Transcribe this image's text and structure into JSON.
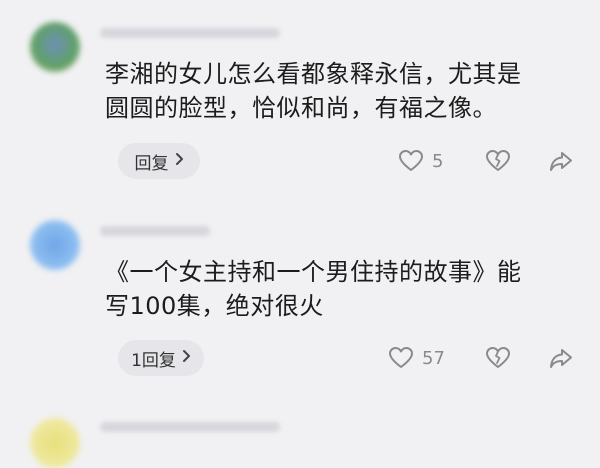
{
  "comments": [
    {
      "text_line1": "李湘的女儿怎么看都象释永信，尤其是",
      "text_line2": "圆圆的脸型，恰似和尚，有福之像。",
      "reply_label": "回复",
      "like_count": "5"
    },
    {
      "text_line1": "《一个女主持和一个男住持的故事》能",
      "text_line2": "写100集，绝对很火",
      "reply_label": "1回复",
      "like_count": "57"
    }
  ],
  "icons": {
    "reply_chevron": "chevron-right-icon",
    "like": "heart-icon",
    "dislike": "broken-heart-icon",
    "share": "share-arrow-icon"
  },
  "colors": {
    "background": "#f1f1f3",
    "reply_pill": "#e6e6ea",
    "icon_gray": "#8a8a8e"
  }
}
